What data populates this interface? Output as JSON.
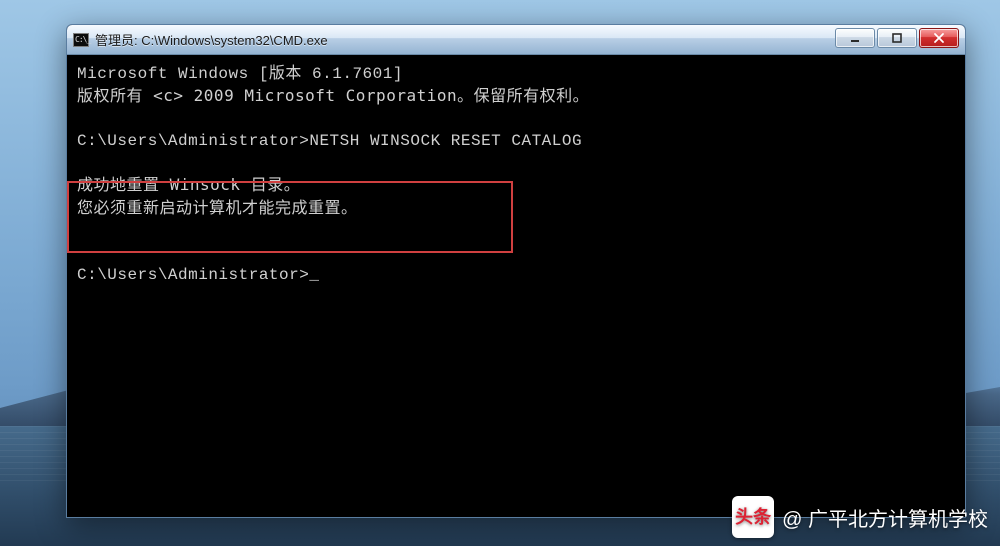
{
  "window": {
    "title": "管理员: C:\\Windows\\system32\\CMD.exe"
  },
  "terminal": {
    "line1": "Microsoft Windows [版本 6.1.7601]",
    "line2": "版权所有 <c> 2009 Microsoft Corporation。保留所有权利。",
    "blank1": "",
    "prompt1_path": "C:\\Users\\Administrator>",
    "prompt1_cmd": "NETSH WINSOCK RESET CATALOG",
    "blank2": "",
    "result1": "成功地重置 Winsock 目录。",
    "result2": "您必须重新启动计算机才能完成重置。",
    "blank3": "",
    "blank4": "",
    "prompt2_path": "C:\\Users\\Administrator>",
    "cursor": "_"
  },
  "controls": {
    "minimize_name": "minimize-button",
    "maximize_name": "maximize-button",
    "close_name": "close-button"
  },
  "watermark": {
    "logo_text": "头条",
    "text": "@ 广平北方计算机学校"
  }
}
